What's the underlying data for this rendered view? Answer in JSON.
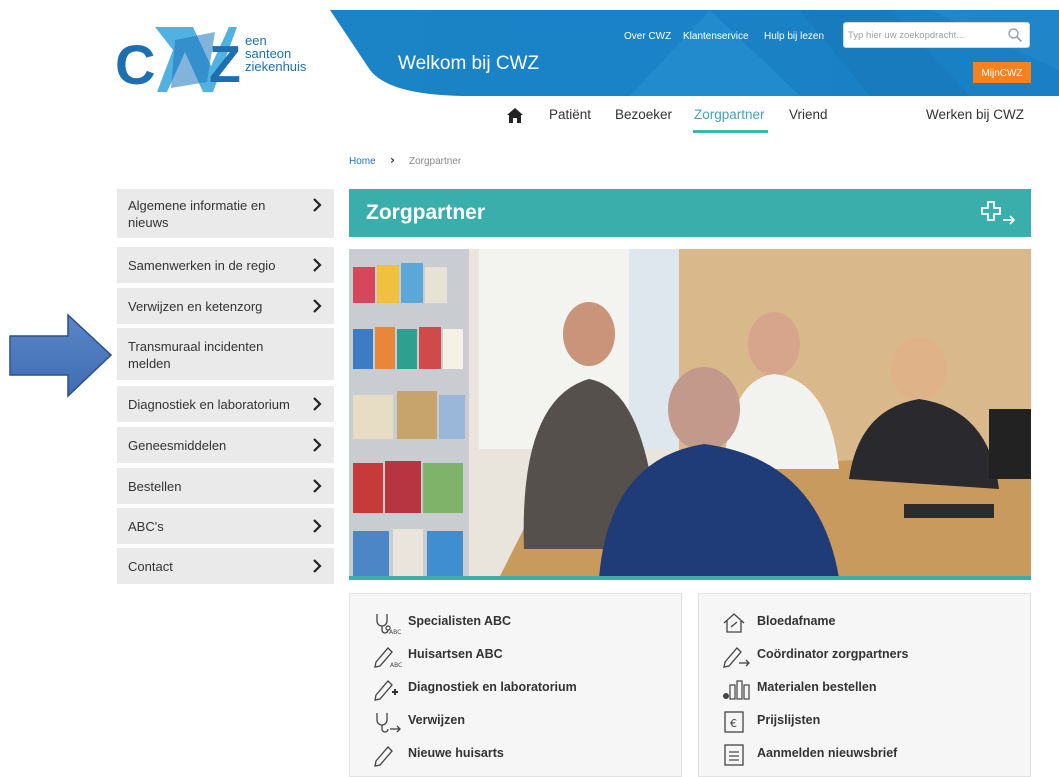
{
  "brand": {
    "logo_letters": "CWZ",
    "tagline": [
      "een",
      "santeon",
      "ziekenhuis"
    ],
    "welcome": "Welkom bij CWZ",
    "colors": {
      "blue": "#1d6fb0",
      "teal": "#3aaeaa",
      "orange": "#f5821f"
    }
  },
  "toplinks": [
    "Over CWZ",
    "Klantenservice",
    "Hulp bij lezen"
  ],
  "search": {
    "placeholder": "Typ hier uw zoekopdracht...",
    "icon": "search-icon"
  },
  "mijn_button": "MijnCWZ",
  "nav": {
    "home_icon": "home-icon",
    "items": [
      "Patiënt",
      "Bezoeker",
      "Zorgpartner",
      "Vriend"
    ],
    "active": "Zorgpartner",
    "werken": "Werken bij CWZ"
  },
  "breadcrumb": {
    "home": "Home",
    "separator": "›",
    "current": "Zorgpartner"
  },
  "sidebar": {
    "items": [
      {
        "label": "Algemene informatie en nieuws",
        "chevron": true
      },
      {
        "label": "Samenwerken in de regio",
        "chevron": true
      },
      {
        "label": "Verwijzen en ketenzorg",
        "chevron": true
      },
      {
        "label": "Transmuraal incidenten melden",
        "chevron": false
      },
      {
        "label": "Diagnostiek en laboratorium",
        "chevron": true
      },
      {
        "label": "Geneesmiddelen",
        "chevron": true
      },
      {
        "label": "Bestellen",
        "chevron": true
      },
      {
        "label": "ABC's",
        "chevron": true
      },
      {
        "label": "Contact",
        "chevron": true
      }
    ]
  },
  "page_title": "Zorgpartner",
  "cards": {
    "left": [
      {
        "label": "Specialisten ABC",
        "icon": "stethoscope-abc-icon"
      },
      {
        "label": "Huisartsen ABC",
        "icon": "pen-abc-icon"
      },
      {
        "label": "Diagnostiek en laboratorium",
        "icon": "pen-plus-icon"
      },
      {
        "label": "Verwijzen",
        "icon": "stethoscope-arrow-icon"
      },
      {
        "label": "Nieuwe huisarts",
        "icon": "pen-icon"
      }
    ],
    "right": [
      {
        "label": "Bloedafname",
        "icon": "house-icon"
      },
      {
        "label": "Coördinator zorgpartners",
        "icon": "pen-arrow-icon"
      },
      {
        "label": "Materialen bestellen",
        "icon": "supplies-icon"
      },
      {
        "label": "Prijslijsten",
        "icon": "euro-icon"
      },
      {
        "label": "Aanmelden nieuwsbrief",
        "icon": "document-icon"
      }
    ]
  }
}
